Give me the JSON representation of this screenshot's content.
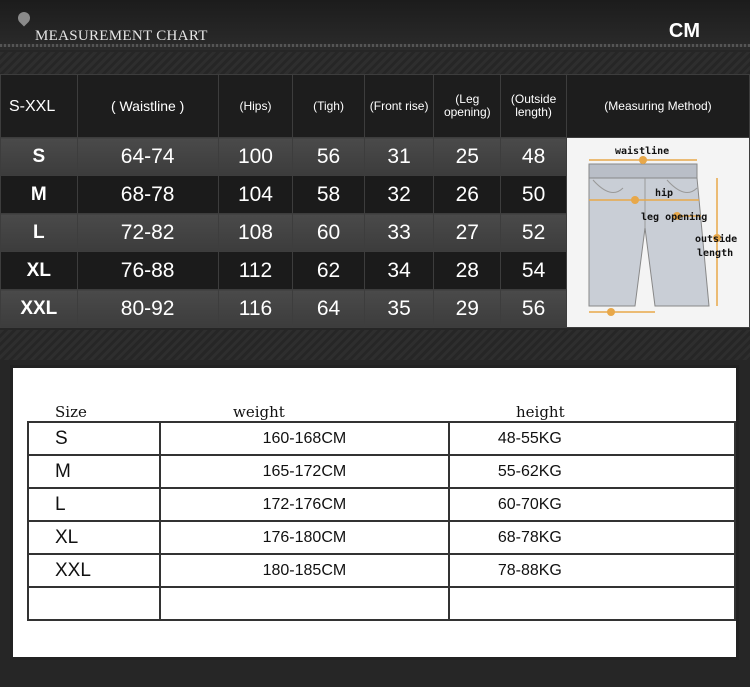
{
  "header": {
    "title": "MEASUREMENT CHART",
    "unit": "CM"
  },
  "size_table": {
    "headers": [
      "S-XXL",
      "( Waistline )",
      "(Hips)",
      "(Tigh)",
      "(Front rise)",
      "(Leg opening)",
      "(Outside length)",
      "(Measuring Method)"
    ],
    "rows": [
      {
        "size": "S",
        "waist": "64-74",
        "hips": "100",
        "thigh": "56",
        "rise": "31",
        "leg": "25",
        "length": "48"
      },
      {
        "size": "M",
        "waist": "68-78",
        "hips": "104",
        "thigh": "58",
        "rise": "32",
        "leg": "26",
        "length": "50"
      },
      {
        "size": "L",
        "waist": "72-82",
        "hips": "108",
        "thigh": "60",
        "rise": "33",
        "leg": "27",
        "length": "52"
      },
      {
        "size": "XL",
        "waist": "76-88",
        "hips": "112",
        "thigh": "62",
        "rise": "34",
        "leg": "28",
        "length": "54"
      },
      {
        "size": "XXL",
        "waist": "80-92",
        "hips": "116",
        "thigh": "64",
        "rise": "35",
        "leg": "29",
        "length": "56"
      }
    ],
    "method_labels": {
      "waist": "waistline",
      "hip": "hip",
      "leg": "leg opening",
      "outside1": "outside",
      "outside2": "length"
    }
  },
  "weight_table": {
    "headers": {
      "size": "Size",
      "weight": "weight",
      "height": "height"
    },
    "rows": [
      {
        "size": "S",
        "weight": "160-168CM",
        "height": "48-55KG"
      },
      {
        "size": "M",
        "weight": "165-172CM",
        "height": "55-62KG"
      },
      {
        "size": "L",
        "weight": "172-176CM",
        "height": "60-70KG"
      },
      {
        "size": "XL",
        "weight": "176-180CM",
        "height": "68-78KG"
      },
      {
        "size": "XXL",
        "weight": "180-185CM",
        "height": "78-88KG"
      },
      {
        "size": "",
        "weight": "",
        "height": ""
      }
    ]
  },
  "colors": {
    "background": "#262626",
    "row_light": "#444444",
    "row_dark": "#1b1b1b",
    "marker": "#e8a84a"
  }
}
